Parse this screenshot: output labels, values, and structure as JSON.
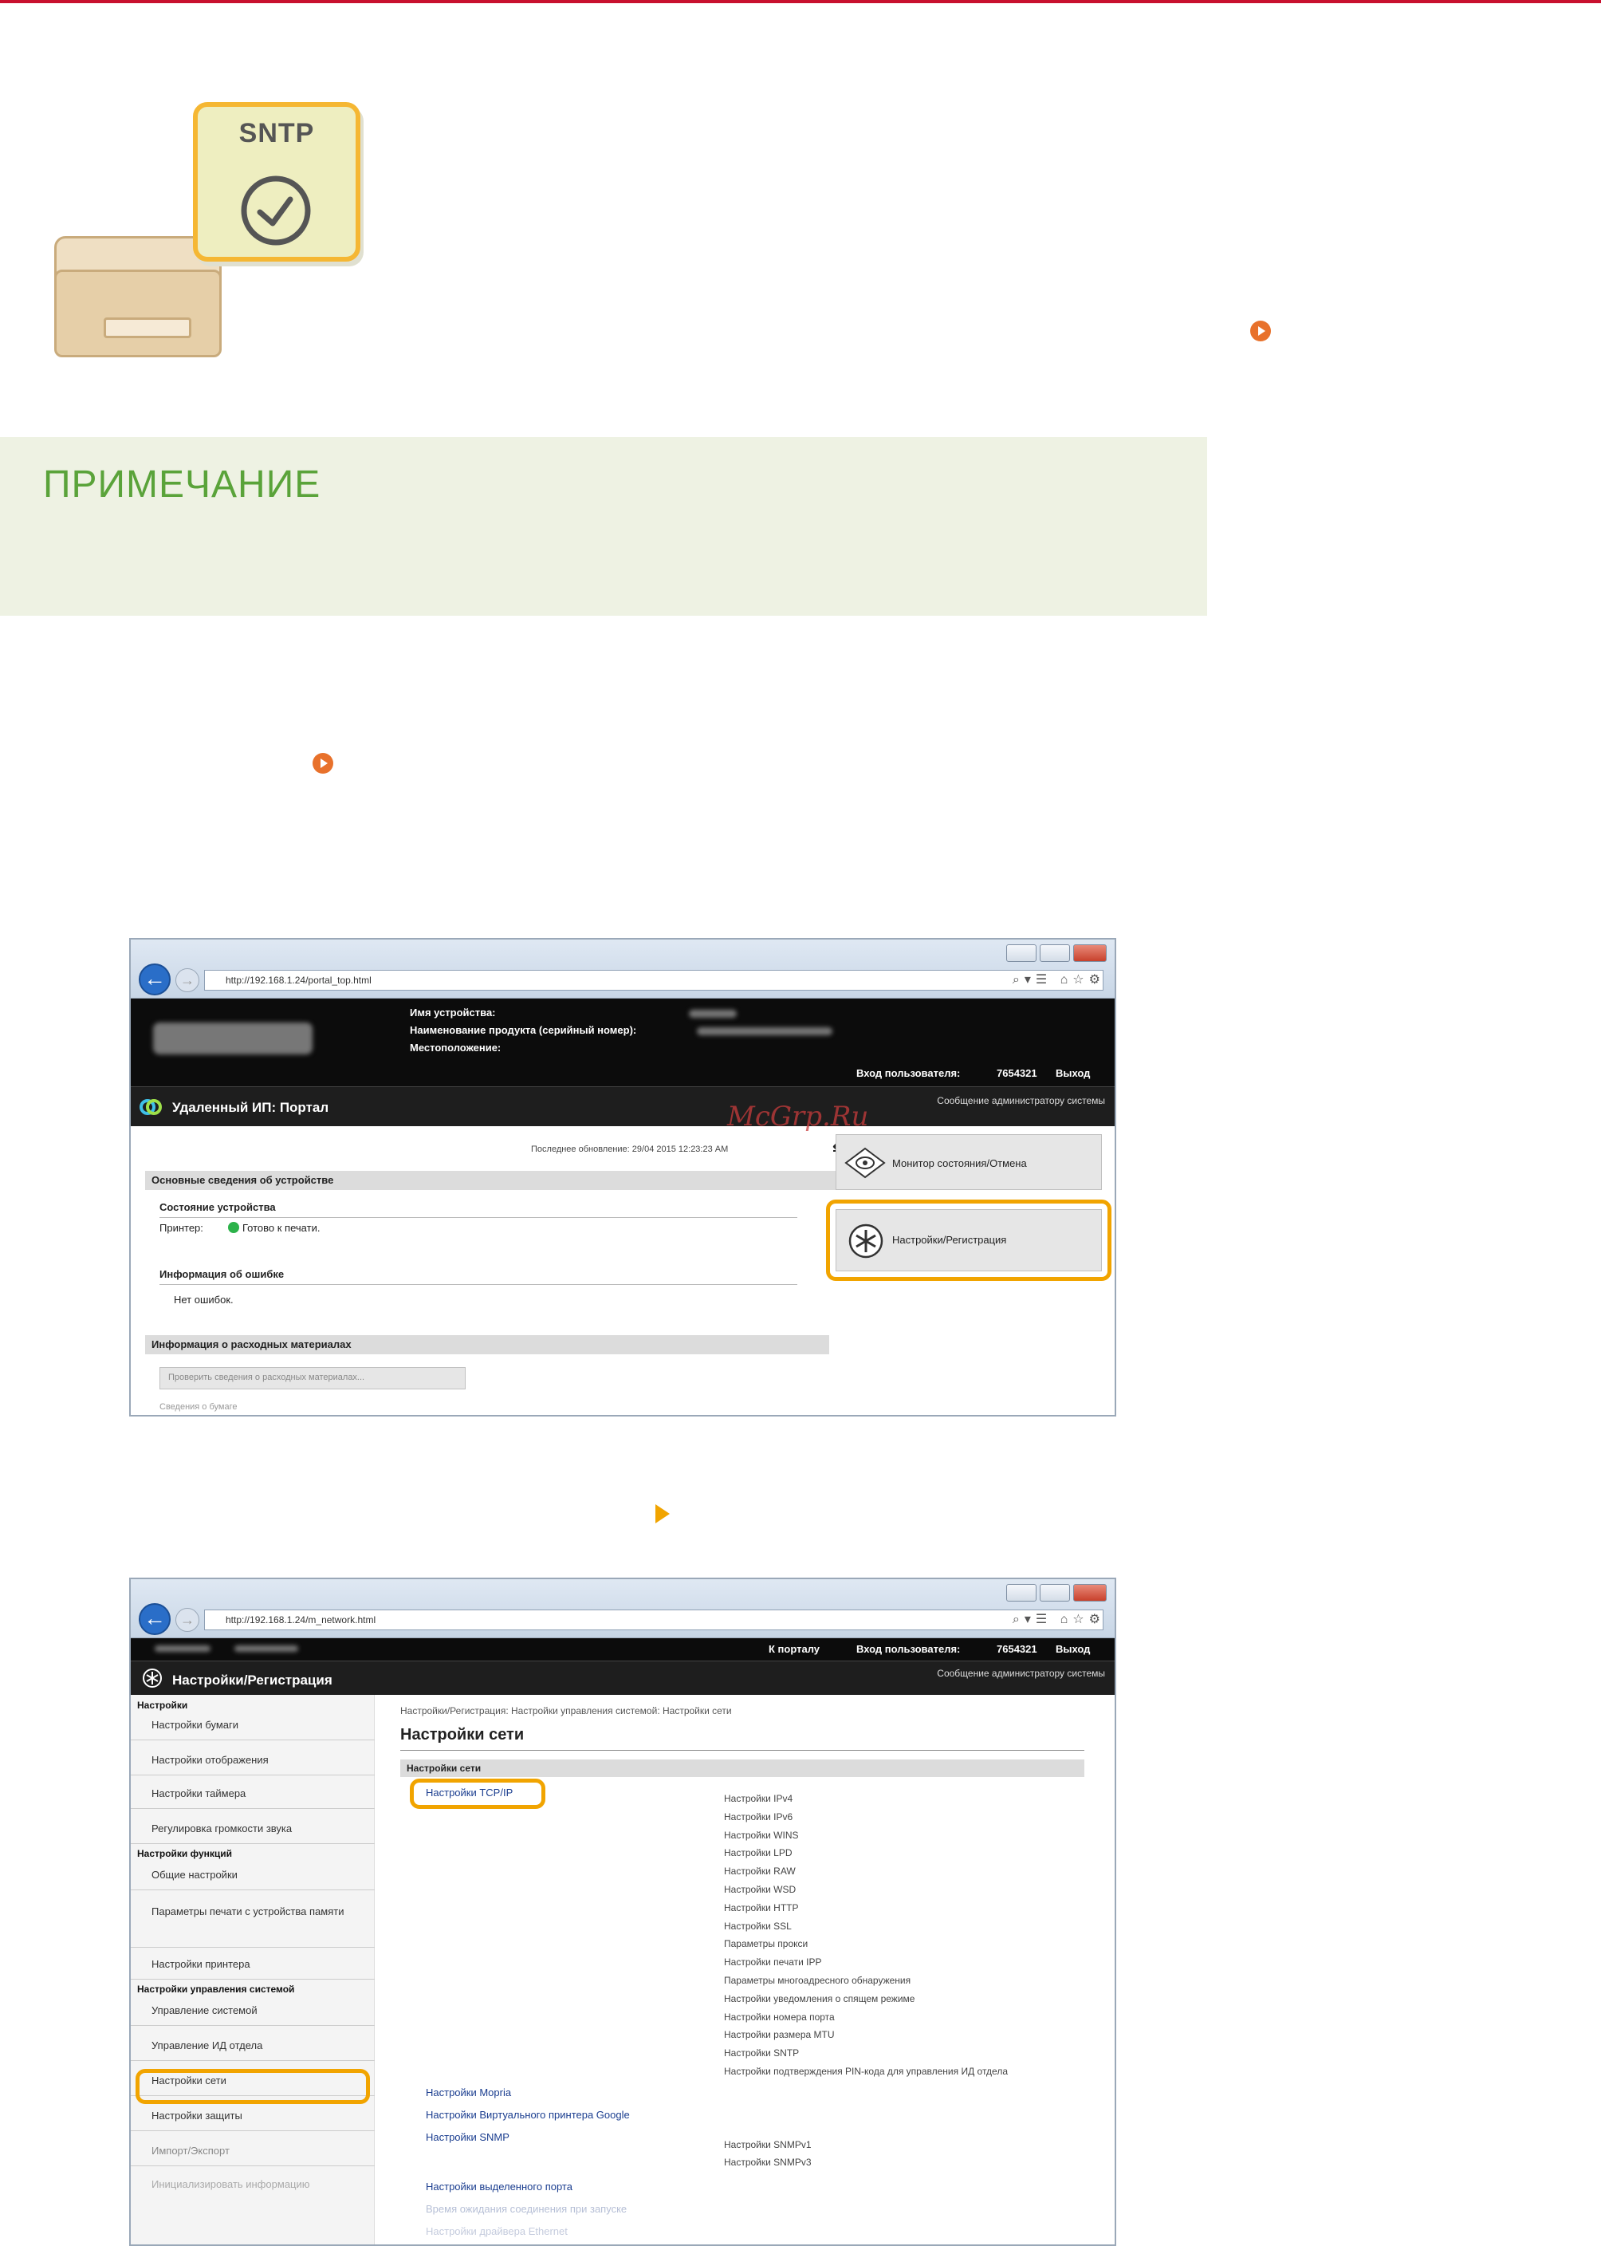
{
  "hero": {
    "icon_label": "SNTP"
  },
  "note": {
    "title": "ПРИМЕЧАНИЕ"
  },
  "shot1": {
    "url": "http://192.168.1.24/portal_top.html",
    "device_name_label": "Имя устройства:",
    "product_label": "Наименование продукта (серийный номер):",
    "location_label": "Местоположение:",
    "login_label": "Вход пользователя:",
    "user_id": "7654321",
    "logout": "Выход",
    "app_title": "Удаленный ИП: Портал",
    "admin_message": "Сообщение администратору системы",
    "last_update": "Последнее обновление: 29/04 2015 12:23:23 AM",
    "basic_info": "Основные сведения об устройстве",
    "device_status": "Состояние устройства",
    "printer_label": "Принтер:",
    "printer_status": "Готово к печати.",
    "error_info": "Информация об ошибке",
    "no_errors": "Нет ошибок.",
    "consumables": "Информация о расходных материалах",
    "check_consumables": "Проверить сведения о расходных материалах...",
    "paper_info": "Сведения о бумаге",
    "monitor_btn": "Монитор состояния/Отмена",
    "settings_btn": "Настройки/Регистрация"
  },
  "shot2": {
    "url": "http://192.168.1.24/m_network.html",
    "to_portal": "К порталу",
    "login_label": "Вход пользователя:",
    "user_id": "7654321",
    "logout": "Выход",
    "app_title": "Настройки/Регистрация",
    "admin_message": "Сообщение администратору системы",
    "breadcrumb": "Настройки/Регистрация: Настройки управления системой: Настройки сети",
    "page_title": "Настройки сети",
    "section": "Настройки сети",
    "sidebar": {
      "group1": "Настройки",
      "g1_items": [
        "Настройки бумаги",
        "Настройки отображения",
        "Настройки таймера",
        "Регулировка громкости звука"
      ],
      "group2": "Настройки функций",
      "g2_items": [
        "Общие настройки",
        "Параметры печати с устройства памяти",
        "Настройки принтера"
      ],
      "group3": "Настройки управления системой",
      "g3_items": [
        "Управление системой",
        "Управление ИД отдела",
        "Настройки сети",
        "Настройки защиты",
        "Импорт/Экспорт",
        "Инициализировать информацию"
      ]
    },
    "links": {
      "tcpip": "Настройки TCP/IP",
      "mopria": "Настройки Mopria",
      "google": "Настройки Виртуального принтера Google",
      "snmp": "Настройки SNMP",
      "dedicated_port": "Настройки выделенного порта",
      "wait_time": "Время ожидания соединения при запуске",
      "ethernet": "Настройки драйвера Ethernet"
    },
    "tcpip_subs": [
      "Настройки IPv4",
      "Настройки IPv6",
      "Настройки WINS",
      "Настройки LPD",
      "Настройки RAW",
      "Настройки WSD",
      "Настройки HTTP",
      "Настройки SSL",
      "Параметры прокси",
      "Настройки печати IPP",
      "Параметры многоадресного обнаружения",
      "Настройки уведомления о спящем режиме",
      "Настройки номера порта",
      "Настройки размера MTU",
      "Настройки SNTP",
      "Настройки подтверждения PIN-кода для управления ИД отдела"
    ],
    "snmp_subs": [
      "Настройки SNMPv1",
      "Настройки SNMPv3"
    ]
  },
  "watermark": "McGrp.Ru"
}
